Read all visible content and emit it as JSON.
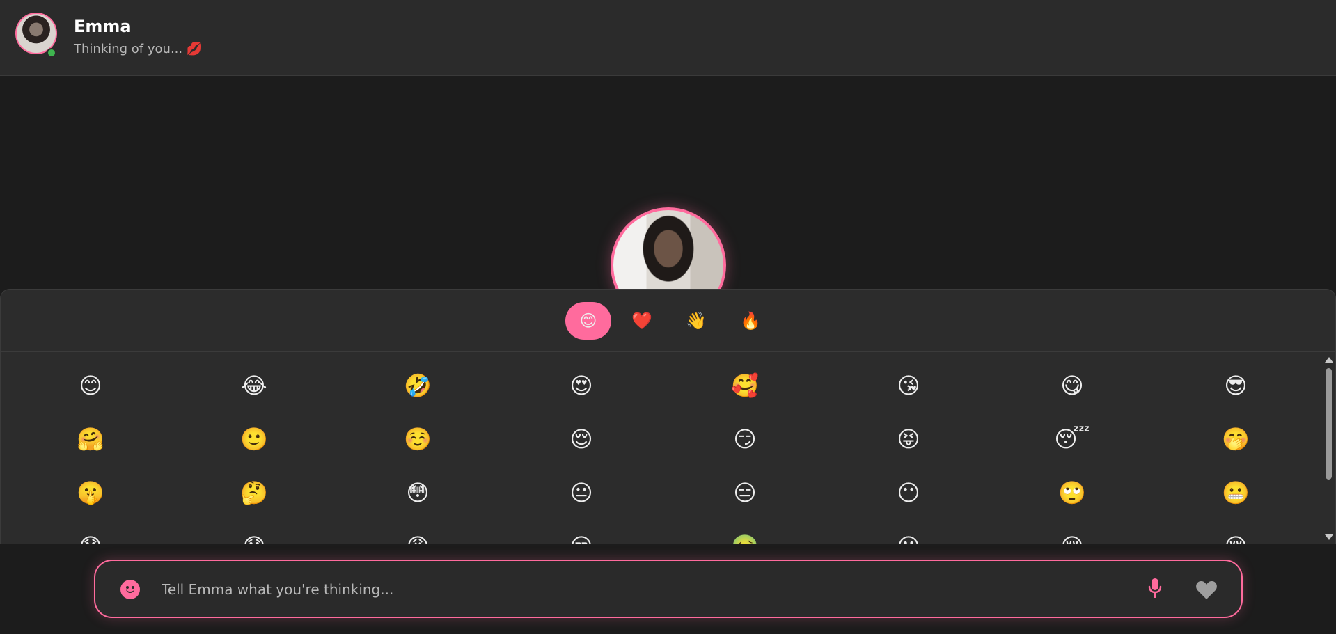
{
  "header": {
    "name": "Emma",
    "status": "Thinking of you... 💋",
    "online_color": "#3fb54f"
  },
  "emoji_picker": {
    "categories": [
      {
        "icon": "😊",
        "active": true
      },
      {
        "icon": "❤️",
        "active": false
      },
      {
        "icon": "👋",
        "active": false
      },
      {
        "icon": "🔥",
        "active": false
      }
    ],
    "rows": [
      [
        "😊",
        "😂",
        "🤣",
        "😍",
        "🥰",
        "😘",
        "😋",
        "😎"
      ],
      [
        "🤗",
        "🙂",
        "☺️",
        "😌",
        "😏",
        "😝",
        "😴",
        "🤭"
      ],
      [
        "🤫",
        "🤔",
        "😳",
        "😐",
        "😑",
        "😶",
        "🙄",
        "😬"
      ],
      [
        "😓",
        "😞",
        "😩",
        "😒",
        "🤢",
        "😕",
        "😔",
        "😪"
      ]
    ]
  },
  "composer": {
    "placeholder": "Tell Emma what you're thinking..."
  },
  "colors": {
    "accent": "#ff6b9d",
    "background": "#1c1c1c",
    "panel": "#2c2c2c"
  }
}
